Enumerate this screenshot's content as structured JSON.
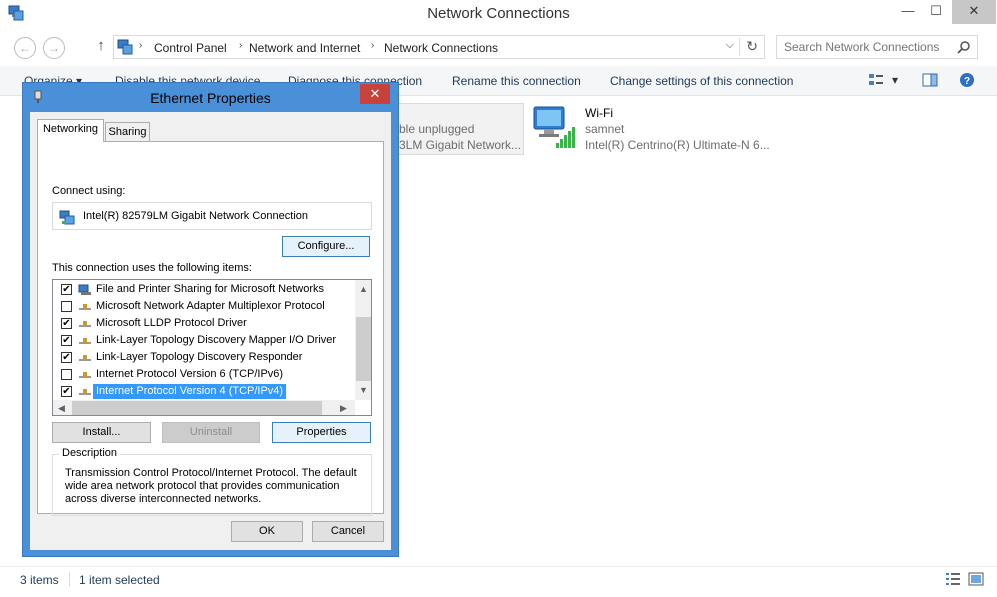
{
  "window": {
    "title": "Network Connections",
    "min": "—",
    "max": "☐",
    "close": "✕"
  },
  "nav": {
    "back": "←",
    "forward": "→",
    "up": "↑"
  },
  "address": {
    "breadcrumbs": [
      "Control Panel",
      "Network and Internet",
      "Network Connections"
    ],
    "sep": "›",
    "dropdown": "⌵",
    "refresh": "↻"
  },
  "search": {
    "placeholder": "Search Network Connections"
  },
  "commands": {
    "organize": "Organize ▾",
    "disable": "Disable this network device",
    "diagnose": "Diagnose this connection",
    "rename": "Rename this connection",
    "change": "Change settings of this connection",
    "view_dropdown": "▾"
  },
  "connections": {
    "ethernet": {
      "status": "ble unplugged",
      "adapter": "3LM Gigabit Network..."
    },
    "wifi": {
      "name": "Wi-Fi",
      "network": "samnet",
      "adapter": "Intel(R) Centrino(R) Ultimate-N 6..."
    }
  },
  "statusbar": {
    "count": "3 items",
    "selected": "1 item selected"
  },
  "dialog": {
    "title": "Ethernet Properties",
    "close": "✕",
    "tabs": [
      "Networking",
      "Sharing"
    ],
    "connect_using_label": "Connect using:",
    "adapter_name": "Intel(R) 82579LM Gigabit Network Connection",
    "configure": "Configure...",
    "items_label": "This connection uses the following items:",
    "items": [
      {
        "label": "File and Printer Sharing for Microsoft Networks",
        "checked": true
      },
      {
        "label": "Microsoft Network Adapter Multiplexor Protocol",
        "checked": false
      },
      {
        "label": "Microsoft LLDP Protocol Driver",
        "checked": true
      },
      {
        "label": "Link-Layer Topology Discovery Mapper I/O Driver",
        "checked": true
      },
      {
        "label": "Link-Layer Topology Discovery Responder",
        "checked": true
      },
      {
        "label": "Internet Protocol Version 6 (TCP/IPv6)",
        "checked": false
      },
      {
        "label": "Internet Protocol Version 4 (TCP/IPv4)",
        "checked": true,
        "selected": true
      }
    ],
    "check_glyph": "✔",
    "install": "Install...",
    "uninstall": "Uninstall",
    "properties": "Properties",
    "description_title": "Description",
    "description": "Transmission Control Protocol/Internet Protocol. The default wide area network protocol that provides communication across diverse interconnected networks.",
    "ok": "OK",
    "cancel": "Cancel",
    "scroll": {
      "up": "▲",
      "down": "▼",
      "left": "◀",
      "right": "▶"
    }
  },
  "colors": {
    "dialog_frame": "#4a90d9",
    "selection": "#3399ff",
    "link_text": "#1e395b"
  },
  "icons": [
    "network-connections-icon",
    "search-icon",
    "wifi-icon",
    "network-adapter-icon",
    "protocol-icon",
    "view-options-icon",
    "preview-pane-icon",
    "help-icon"
  ]
}
